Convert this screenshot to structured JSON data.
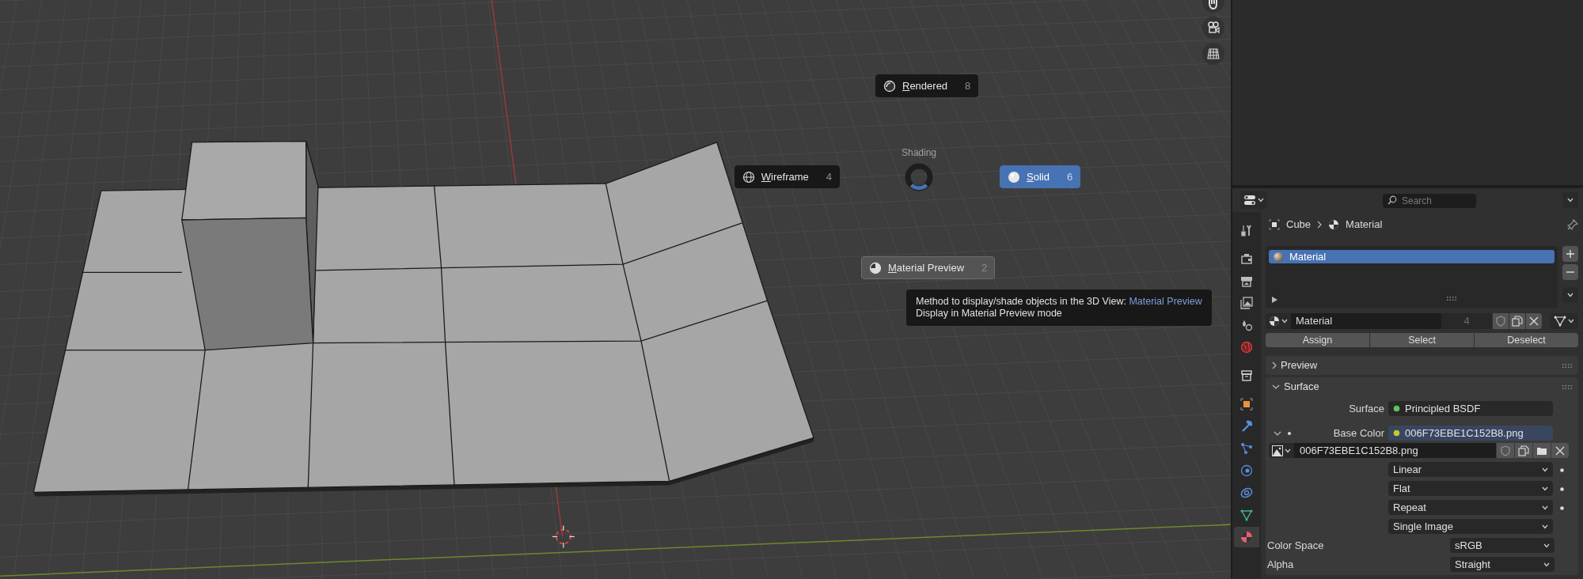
{
  "pie_menu": {
    "title": "Shading",
    "items": [
      {
        "kind": "rendered",
        "label": "Rendered",
        "shortcut": "8",
        "selected": false,
        "hovered": false
      },
      {
        "kind": "wireframe",
        "label": "Wireframe",
        "shortcut": "4",
        "selected": false,
        "hovered": false
      },
      {
        "kind": "solid",
        "label": "Solid",
        "shortcut": "6",
        "selected": true,
        "hovered": false
      },
      {
        "kind": "material",
        "label": "Material Preview",
        "shortcut": "2",
        "selected": false,
        "hovered": true
      }
    ]
  },
  "tooltip": {
    "text": "Method to display/shade objects in the 3D View:",
    "value": "Material Preview",
    "description": "Display in Material Preview mode"
  },
  "properties": {
    "search_placeholder": "Search",
    "tabs": [
      {
        "kind": "tool",
        "selected": false
      },
      {
        "kind": "render",
        "selected": false
      },
      {
        "kind": "output",
        "selected": false
      },
      {
        "kind": "view_layer",
        "selected": false
      },
      {
        "kind": "scene",
        "selected": false
      },
      {
        "kind": "world",
        "selected": false
      },
      {
        "kind": "collection",
        "selected": false
      },
      {
        "kind": "object",
        "selected": false
      },
      {
        "kind": "modifiers",
        "selected": false
      },
      {
        "kind": "particles",
        "selected": false
      },
      {
        "kind": "physics",
        "selected": false
      },
      {
        "kind": "constraints",
        "selected": false
      },
      {
        "kind": "data",
        "selected": false
      },
      {
        "kind": "material",
        "selected": true
      }
    ],
    "breadcrumb": [
      "Cube",
      "Material"
    ],
    "material_slots": [
      {
        "name": "Material",
        "selected": true
      }
    ],
    "material_name": "Material",
    "user_count": "4",
    "slot_buttons": [
      "Assign",
      "Select",
      "Deselect"
    ],
    "panels": [
      {
        "title": "Preview",
        "expanded": false
      },
      {
        "title": "Surface",
        "expanded": true
      }
    ],
    "surface": {
      "label": "Surface",
      "value": "Principled BSDF",
      "color": "#5ec25e"
    },
    "base_color": {
      "label": "Base Color",
      "value": "006F73EBE1C152B8.png",
      "color": "#c7c729",
      "expanded": true
    },
    "image_name": "006F73EBE1C152B8.png",
    "dropdowns": [
      {
        "value": "Linear",
        "keyframe": true
      },
      {
        "value": "Flat",
        "keyframe": true
      },
      {
        "value": "Repeat",
        "keyframe": true
      },
      {
        "value": "Single Image",
        "keyframe": false
      }
    ],
    "color_space": {
      "label": "Color Space",
      "value": "sRGB"
    },
    "alpha": {
      "label": "Alpha",
      "value": "Straight"
    }
  }
}
